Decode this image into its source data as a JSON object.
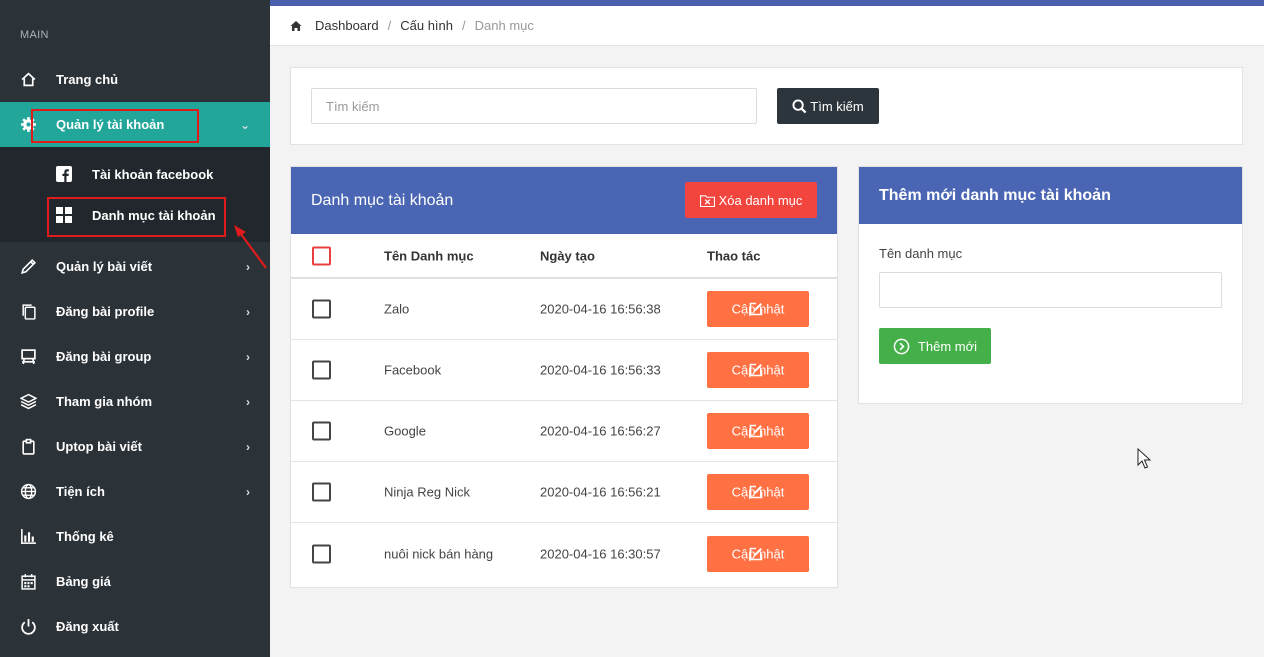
{
  "sidebar": {
    "section": "MAIN",
    "items": [
      {
        "label": "Trang chủ",
        "icon": "home-icon"
      },
      {
        "label": "Quản lý tài khoản",
        "icon": "gear-icon",
        "chevron": "⌄"
      },
      {
        "label": "Quản lý bài viết",
        "icon": "pencil-icon",
        "chevron": "›"
      },
      {
        "label": "Đăng bài profile",
        "icon": "copy-icon",
        "chevron": "›"
      },
      {
        "label": "Đăng bài group",
        "icon": "easel-icon",
        "chevron": "›"
      },
      {
        "label": "Tham gia nhóm",
        "icon": "layers-icon",
        "chevron": "›"
      },
      {
        "label": "Uptop bài viết",
        "icon": "clipboard-icon",
        "chevron": "›"
      },
      {
        "label": "Tiện ích",
        "icon": "globe-icon",
        "chevron": "›"
      },
      {
        "label": "Thống kê",
        "icon": "bar-chart-icon"
      },
      {
        "label": "Bảng giá",
        "icon": "calendar-icon"
      },
      {
        "label": "Đăng xuất",
        "icon": "power-icon"
      }
    ],
    "submenu": [
      {
        "label": "Tài khoản facebook",
        "icon": "facebook-icon"
      },
      {
        "label": "Danh mục tài khoản",
        "icon": "grid-icon"
      }
    ]
  },
  "breadcrumb": {
    "home": "Dashboard",
    "sep": "/",
    "mid": "Cấu hình",
    "current": "Danh mục"
  },
  "search": {
    "placeholder": "Tìm kiếm",
    "button": "Tìm kiếm"
  },
  "table_card": {
    "title": "Danh mục tài khoản",
    "delete_button": "Xóa danh mục",
    "columns": [
      "Tên Danh mục",
      "Ngày tạo",
      "Thao tác"
    ],
    "rows": [
      {
        "name": "Zalo",
        "date": "2020-04-16 16:56:38",
        "action": "Cập nhật"
      },
      {
        "name": "Facebook",
        "date": "2020-04-16 16:56:33",
        "action": "Cập nhật"
      },
      {
        "name": "Google",
        "date": "2020-04-16 16:56:27",
        "action": "Cập nhật"
      },
      {
        "name": "Ninja Reg Nick",
        "date": "2020-04-16 16:56:21",
        "action": "Cập nhật"
      },
      {
        "name": "nuôi nick bán hàng",
        "date": "2020-04-16 16:30:57",
        "action": "Cập nhật"
      }
    ]
  },
  "add_card": {
    "title": "Thêm mới danh mục tài khoản",
    "field_label": "Tên danh mục",
    "button": "Thêm mới"
  },
  "colors": {
    "sidebar": "#2b3238",
    "active": "#23a69a",
    "header": "#4a65b3",
    "danger": "#f1453d",
    "update": "#ff7043",
    "success": "#45b049",
    "highlight": "#e01b1b"
  }
}
